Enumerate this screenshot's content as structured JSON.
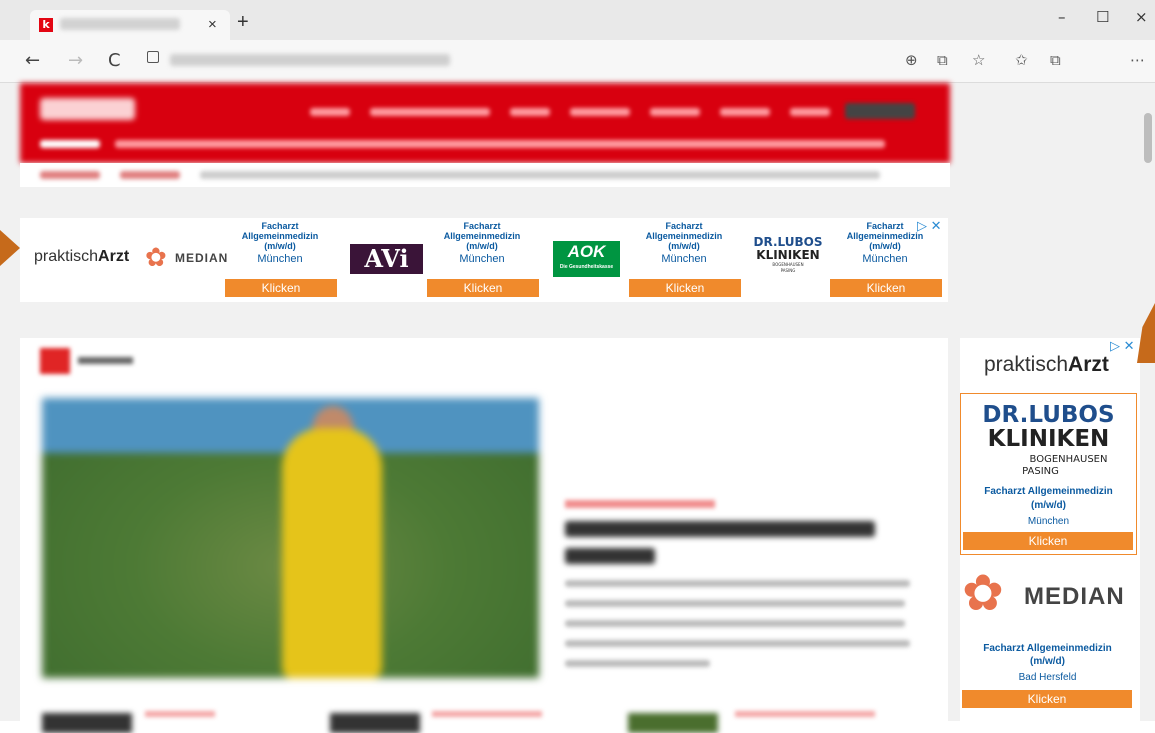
{
  "browser": {
    "tab_favicon": "k",
    "tab_close": "×",
    "new_tab": "+",
    "minimize": "–",
    "maximize": "☐",
    "close": "×",
    "back": "←",
    "forward": "→",
    "reload": "C",
    "toolbar_icons": [
      "⊕",
      "⧉",
      "☆",
      "✩",
      "⧉",
      "⋯"
    ]
  },
  "top_ad": {
    "brand_prefix": "praktisch",
    "brand_bold": "Arzt",
    "median_label": "MEDIAN",
    "avi_label": "AVi",
    "aok_label": "AOK",
    "aok_sub": "Die Gesundheitskasse",
    "drlubos_line1": "DR.LUBOS",
    "drlubos_line2": "KLINIKEN",
    "drlubos_line3": "BOGENHAUSEN",
    "drlubos_line4": "PASING",
    "adchoice": "▷ ✕",
    "cells": [
      {
        "l1": "Facharzt",
        "l2": "Allgemeinmedizin",
        "l3": "(m/w/d)",
        "city": "München",
        "btn": "Klicken"
      },
      {
        "l1": "Facharzt",
        "l2": "Allgemeinmedizin",
        "l3": "(m/w/d)",
        "city": "München",
        "btn": "Klicken"
      },
      {
        "l1": "Facharzt",
        "l2": "Allgemeinmedizin",
        "l3": "(m/w/d)",
        "city": "München",
        "btn": "Klicken"
      },
      {
        "l1": "Facharzt",
        "l2": "Allgemeinmedizin",
        "l3": "(m/w/d)",
        "city": "München",
        "btn": "Klicken"
      }
    ]
  },
  "side_ad": {
    "adchoice": "▷ ✕",
    "brand_prefix": "praktisch",
    "brand_bold": "Arzt",
    "drlubos_line1": "DR.LUBOS",
    "drlubos_line2": "KLINIKEN",
    "drlubos_line3": "BOGENHAUSEN",
    "drlubos_line4": "PASING",
    "job1_title": "Facharzt Allgemeinmedizin",
    "job1_sub": "(m/w/d)",
    "job1_city": "München",
    "job1_btn": "Klicken",
    "median_label": "MEDIAN",
    "job2_title": "Facharzt Allgemeinmedizin",
    "job2_sub": "(m/w/d)",
    "job2_city": "Bad Hersfeld",
    "job2_btn": "Klicken"
  },
  "colors": {
    "brand_red": "#d8000f",
    "ad_orange": "#f08a2c",
    "ad_blue": "#0b5aa0",
    "aok_green": "#009541",
    "avi_purple": "#3a1438",
    "arrow_orange": "#c66a1b"
  }
}
